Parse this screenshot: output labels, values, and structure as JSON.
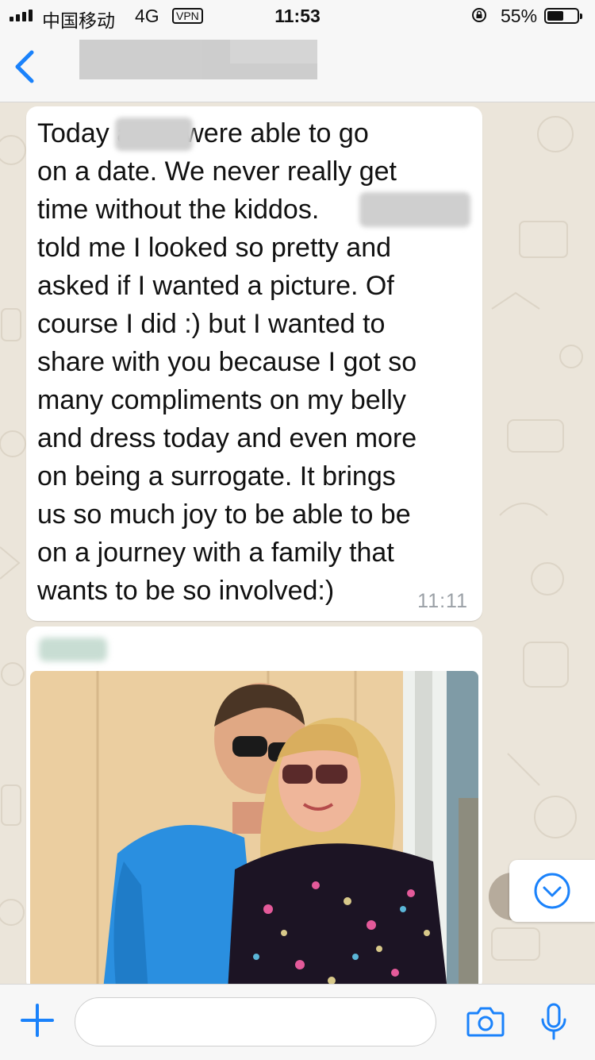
{
  "status_bar": {
    "carrier": "中国移动",
    "network": "4G",
    "vpn": "VPN",
    "time": "11:53",
    "battery_percent": "55%",
    "battery_level": 0.55
  },
  "header": {
    "contact_name": ""
  },
  "messages": [
    {
      "text": "Today          and I were able to go\non a date. We never really get\ntime without the kiddos.\ntold me I looked so pretty and\nasked if I wanted a picture. Of\ncourse I did :) but I wanted to\nshare with you because I got so\nmany compliments on my belly\nand dress today and even more\non being a surrogate. It brings\nus so much joy to be able to be\non a journey with a family that\nwants to be so involved:)",
      "time": "11:11"
    }
  ],
  "input": {
    "placeholder": ""
  },
  "colors": {
    "accent": "#1a82fb",
    "chat_bg": "#ebe5da",
    "bubble": "#ffffff"
  },
  "icons": {
    "back": "chevron-left-icon",
    "plus": "plus-icon",
    "camera": "camera-icon",
    "mic": "microphone-icon",
    "scroll_down": "chevron-down-circle-icon"
  }
}
